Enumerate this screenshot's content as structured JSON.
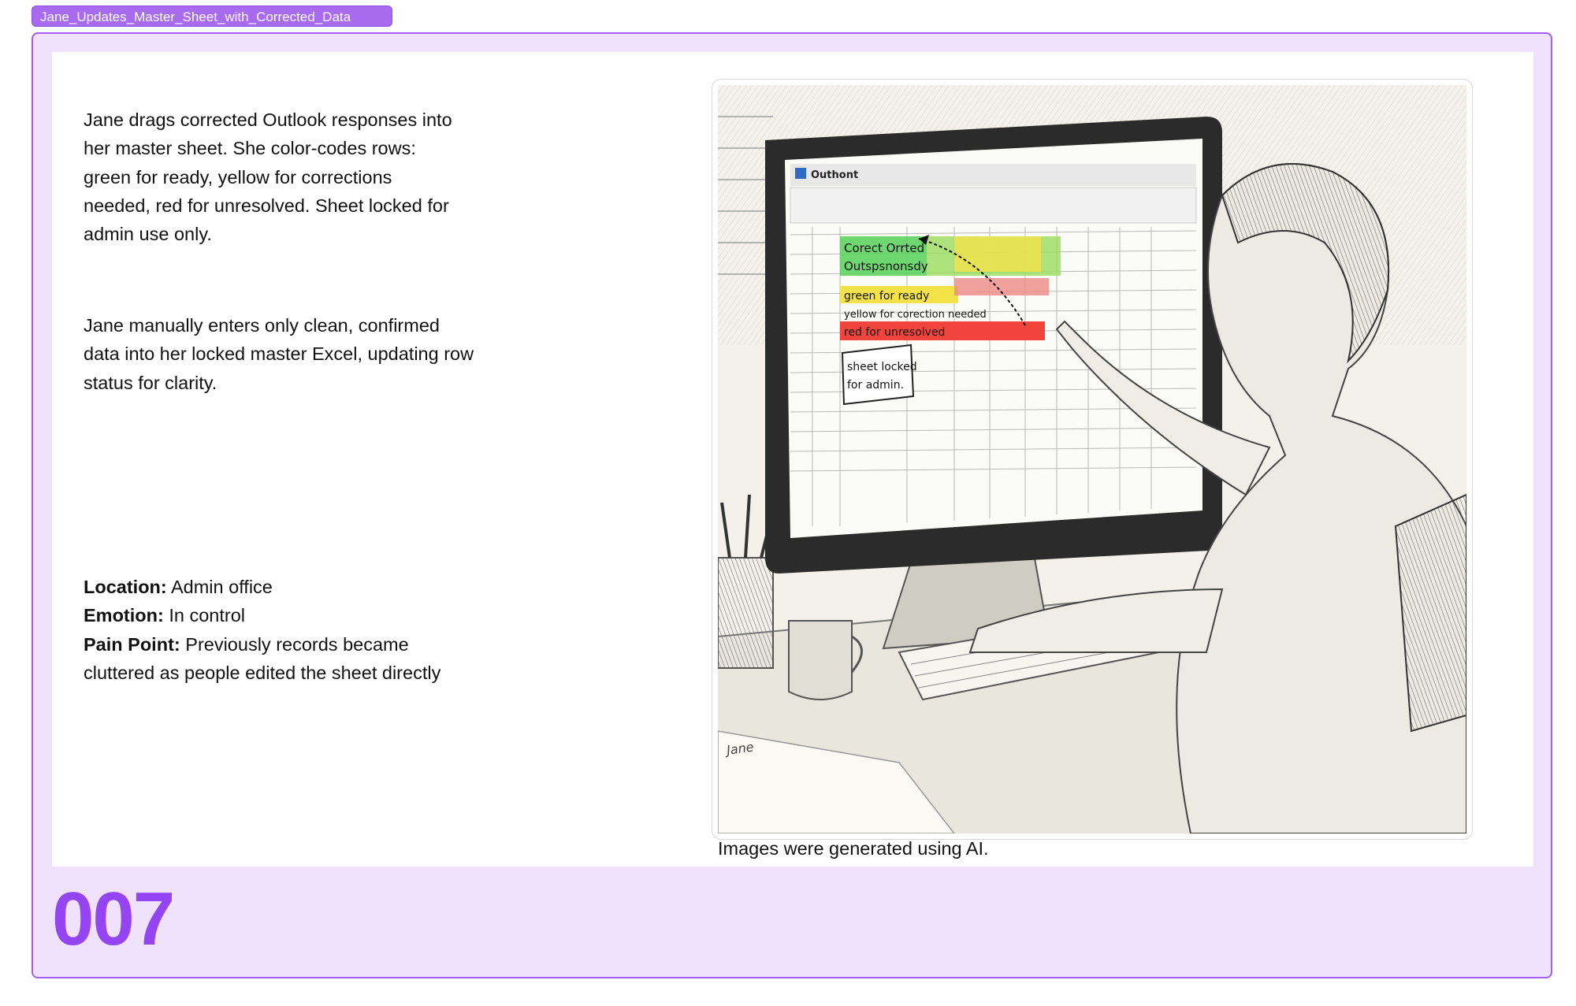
{
  "frame": {
    "name": "Jane_Updates_Master_Sheet_with_Corrected_Data",
    "number": "007"
  },
  "content": {
    "paragraph1": "Jane drags corrected Outlook responses into her master sheet. She color-codes rows: green for ready, yellow for corrections needed, red for unresolved. Sheet locked for admin use only.",
    "paragraph2": "Jane manually enters only clean, confirmed data into her locked master Excel, updating row status for clarity.",
    "location_label": "Location:",
    "location_value": " Admin office",
    "emotion_label": "Emotion:",
    "emotion_value": "  In control",
    "pain_label": "Pain Point:",
    "pain_value": " Previously records became cluttered as people edited the sheet directly"
  },
  "illustration": {
    "app_title": "Outhont",
    "row1_text": "Corect Orrted",
    "row2_text": "Outspsnonsdy",
    "green_label": "green for ready",
    "yellow_label": "yellow for corection needed",
    "red_label": "red for unresolved",
    "note_line1": "sheet locked",
    "note_line2": "for admin.",
    "signature": "Jane",
    "caption": "Images were generated using AI."
  },
  "colors": {
    "accent": "#a35df0",
    "frame_bg": "#f0e1fd",
    "number": "#9444f2",
    "green": "#5fd35f",
    "yellow": "#f3e24a",
    "red": "#f0443c"
  }
}
